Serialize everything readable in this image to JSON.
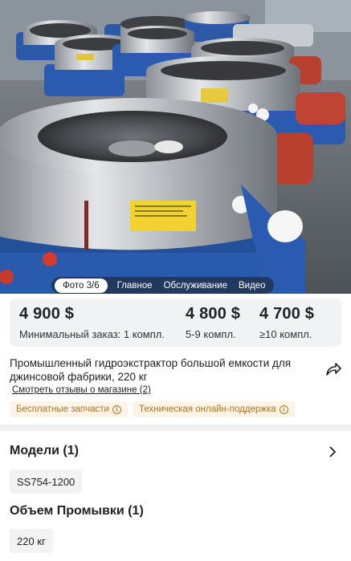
{
  "photo": {
    "tabs": [
      "Фото 3/6",
      "Главное",
      "Обслуживание",
      "Видео"
    ]
  },
  "prices": [
    {
      "value": "4 900 $",
      "note": "Минимальный заказ: 1 компл."
    },
    {
      "value": "4 800 $",
      "note": "5-9 компл."
    },
    {
      "value": "4 700 $",
      "note": "≥10 компл."
    }
  ],
  "product": {
    "title": "Промышленный гидроэкстрактор большой емкости для джинсовой фабрики, 220 кг",
    "reviews_link": "Смотреть отзывы о магазине (2)",
    "badges": [
      "Бесплатные запчасти",
      "Техническая онлайн-поддержка"
    ]
  },
  "models": {
    "title": "Модели (1)",
    "options": [
      "SS754-1200"
    ]
  },
  "capacity": {
    "title": "Объем Промывки (1)",
    "options": [
      "220 кг"
    ]
  },
  "icons": {
    "share": "share-icon",
    "chevron": "chevron-right-icon",
    "info": "info-icon"
  },
  "colors": {
    "badge_bg": "#fdf3e6",
    "badge_text": "#b0761c",
    "price_bg": "#f1f2f4"
  }
}
